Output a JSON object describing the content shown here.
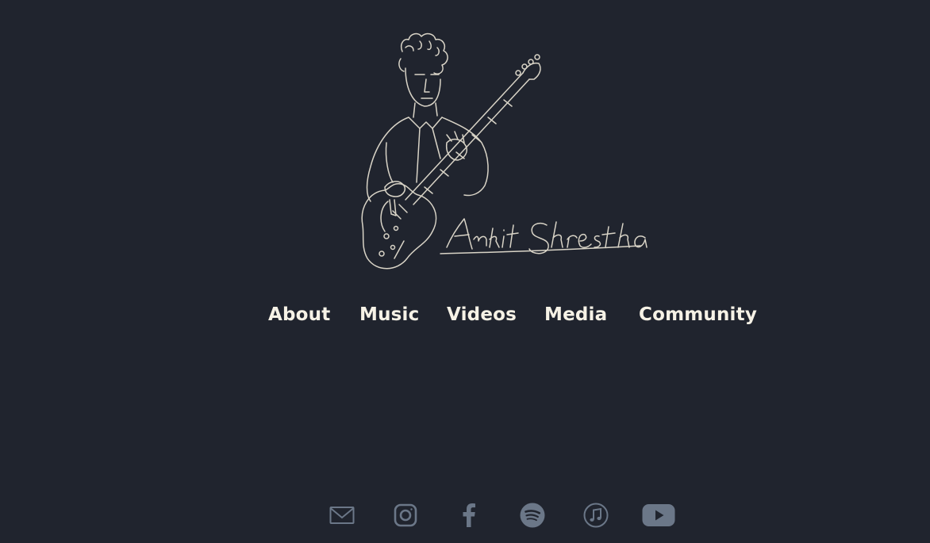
{
  "header": {
    "logo_icon": "guitarist-line-drawing-logo",
    "logo_text": "Ankit Shrestha"
  },
  "nav": {
    "items": [
      {
        "label": "About"
      },
      {
        "label": "Music"
      },
      {
        "label": "Videos"
      },
      {
        "label": "Media"
      },
      {
        "label": "Community"
      }
    ],
    "text_color": "#f6f2e6"
  },
  "social": {
    "icons": [
      "mail-icon",
      "instagram-icon",
      "facebook-icon",
      "spotify-icon",
      "apple-music-icon",
      "youtube-icon"
    ],
    "icon_color": "#6b7788"
  },
  "theme": {
    "background": "#20242e",
    "line_color": "#d9d4c7"
  }
}
